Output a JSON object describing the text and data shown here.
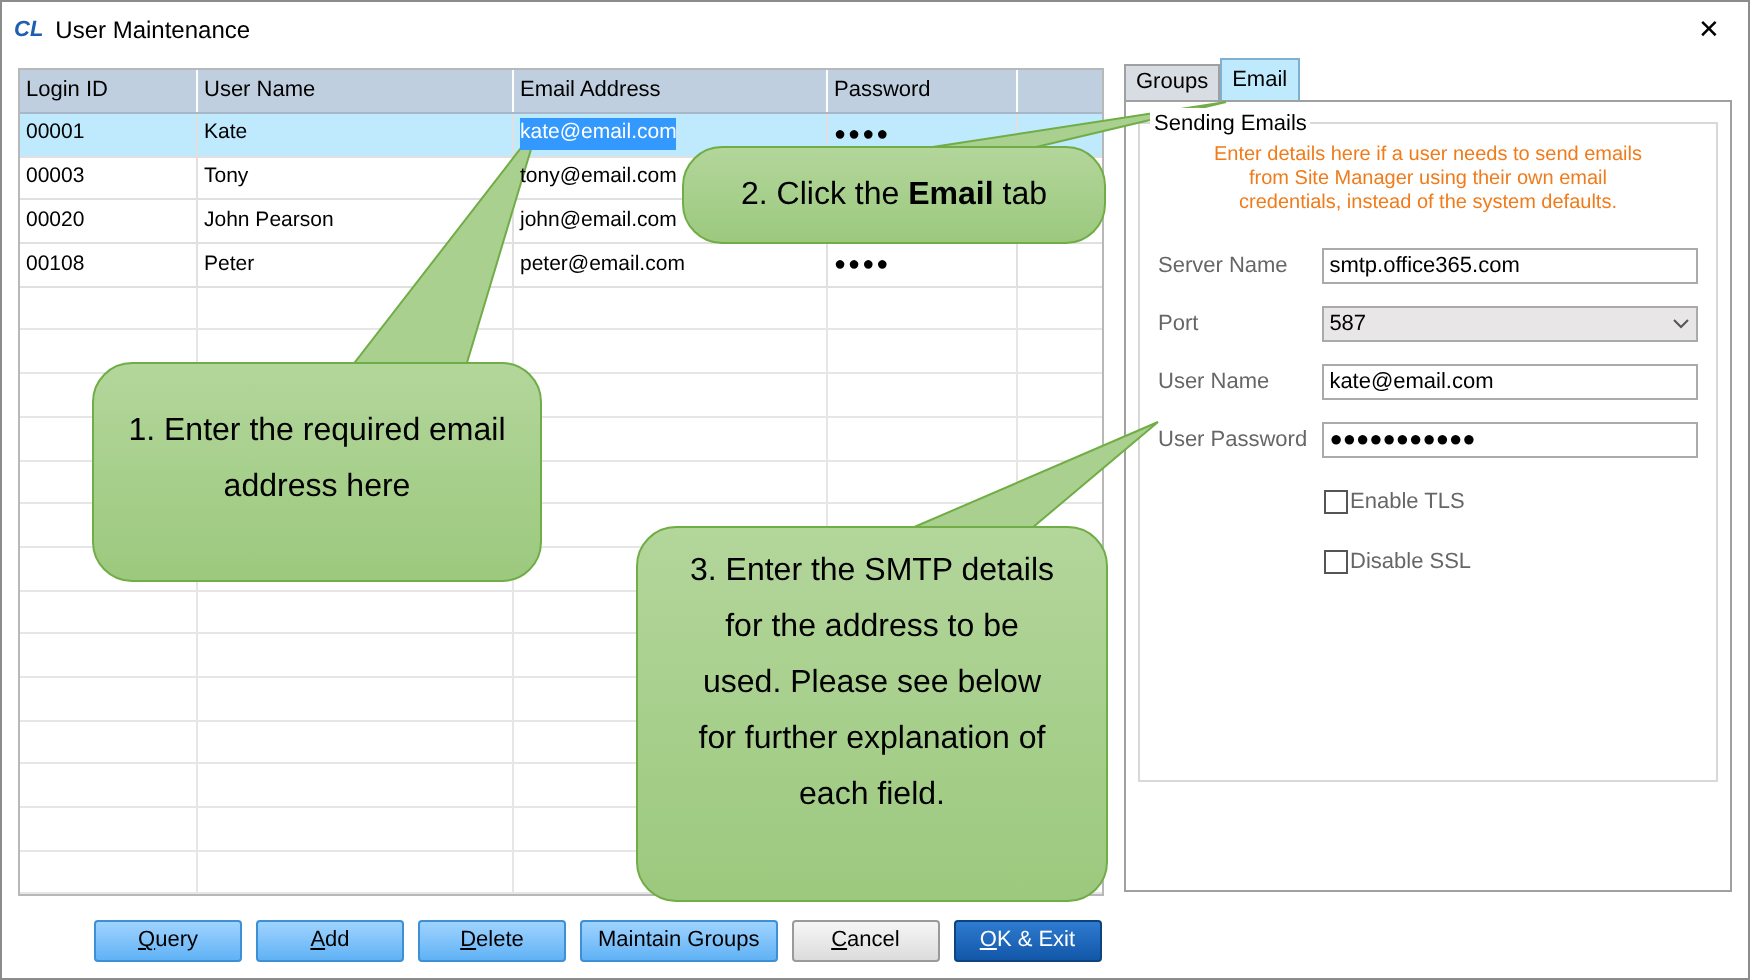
{
  "window": {
    "logo": "CL",
    "title": "User Maintenance",
    "close": "✕"
  },
  "table": {
    "columns": [
      "Login ID",
      "User Name",
      "Email Address",
      "Password"
    ],
    "rows": [
      {
        "selected": true,
        "cells": [
          "00001",
          "Kate",
          "kate@email.com",
          "●●●●"
        ]
      },
      {
        "selected": false,
        "cells": [
          "00003",
          "Tony",
          "tony@email.com"
        ]
      },
      {
        "selected": false,
        "cells": [
          "00020",
          "John Pearson",
          "john@email.com"
        ]
      },
      {
        "selected": false,
        "cells": [
          "00108",
          "Peter",
          "peter@email.com",
          "●●●●"
        ]
      }
    ]
  },
  "tabs": [
    {
      "label": "Groups",
      "selected": false
    },
    {
      "label": "Email",
      "selected": true
    }
  ],
  "email_panel": {
    "group_title": "Sending Emails",
    "note": "Enter details here if a user needs to send emails from Site Manager using their own email credentials, instead of the system defaults.",
    "fields": [
      {
        "kind": "text",
        "label": "Server Name",
        "value": "smtp.office365.com"
      },
      {
        "kind": "select",
        "label": "Port",
        "value": "587"
      },
      {
        "kind": "text",
        "label": "User Name",
        "value": "kate@email.com"
      },
      {
        "kind": "text",
        "label": "User Password",
        "value": "●●●●●●●●●●●"
      }
    ],
    "checkboxes": [
      {
        "label": "Enable TLS",
        "checked": false
      },
      {
        "label": "Disable SSL",
        "checked": false
      }
    ]
  },
  "buttons": [
    {
      "label": "Query",
      "kind": "blue",
      "mnemonic": true
    },
    {
      "label": "Add",
      "kind": "blue",
      "mnemonic": true
    },
    {
      "label": "Delete",
      "kind": "blue",
      "mnemonic": true
    },
    {
      "label": "Maintain Groups",
      "kind": "blue",
      "mnemonic": false
    },
    {
      "label": "Cancel",
      "kind": "plain",
      "mnemonic": true
    },
    {
      "label": "OK & Exit",
      "kind": "primary",
      "mnemonic": true
    }
  ],
  "callouts": [
    "1. Enter the required email address here",
    "2. Click the **Email** tab",
    "3. Enter the SMTP details for the address to be used. Please see below for further explanation of each field."
  ]
}
